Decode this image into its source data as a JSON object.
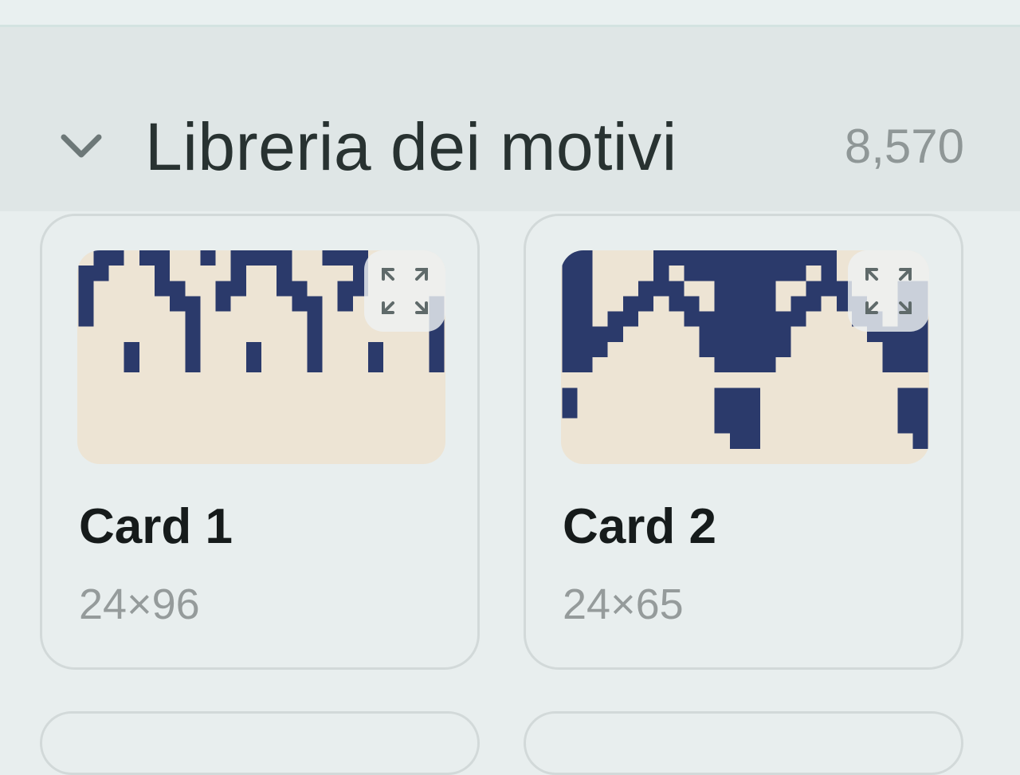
{
  "section": {
    "title": "Libreria dei motivi",
    "count": "8,570",
    "chevron_icon": "chevron-down-icon"
  },
  "cards": [
    {
      "title": "Card 1",
      "dims": "24×96",
      "expand_icon": "expand-icon"
    },
    {
      "title": "Card 2",
      "dims": "24×65",
      "expand_icon": "expand-icon"
    }
  ],
  "colors": {
    "motif": "#2b3a6b",
    "thumb_bg": "#ede4d4",
    "background": "#e8eeee",
    "header_bg": "#dfe6e6"
  }
}
